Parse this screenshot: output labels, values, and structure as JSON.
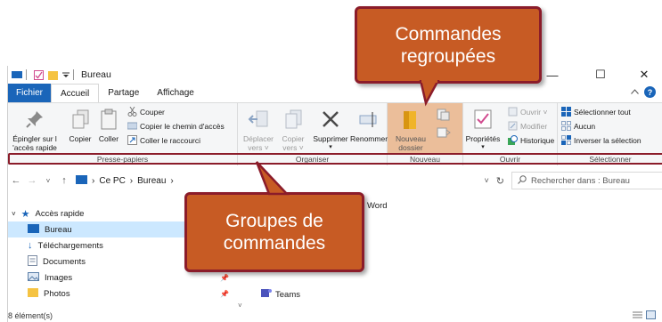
{
  "window": {
    "title": "Bureau",
    "controls": {
      "minimize": "—",
      "maximize": "☐",
      "close": "✕"
    }
  },
  "ribbon_tabs": [
    {
      "label": "Fichier"
    },
    {
      "label": "Accueil"
    },
    {
      "label": "Partage"
    },
    {
      "label": "Affichage"
    }
  ],
  "ribbon": {
    "presse_papiers": {
      "epingler": "Épingler sur l'accès rapide",
      "epingler_l1": "Épingler sur l",
      "epingler_l2": "'accès rapide",
      "copier": "Copier",
      "coller": "Coller",
      "couper": "Couper",
      "copier_chemin": "Copier le chemin d'accès",
      "coller_raccourci": "Coller le raccourci",
      "label": "Presse-papiers"
    },
    "organiser": {
      "deplacer_l1": "Déplacer",
      "deplacer_l2": "vers ˅",
      "copier_l1": "Copier",
      "copier_l2": "vers ˅",
      "supprimer": "Supprimer",
      "renommer": "Renommer",
      "label": "Organiser"
    },
    "nouveau": {
      "dossier_l1": "Nouveau",
      "dossier_l2": "dossier",
      "label": "Nouveau"
    },
    "ouvrir": {
      "proprietes": "Propriétés",
      "ouvrir": "Ouvrir ˅",
      "modifier": "Modifier",
      "historique": "Historique",
      "label": "Ouvrir"
    },
    "selectionner": {
      "tout": "Sélectionner tout",
      "aucun": "Aucun",
      "inverser": "Inverser la sélection",
      "label": "Sélectionner"
    }
  },
  "address_bar": {
    "path": [
      "Ce PC",
      "Bureau"
    ],
    "search_placeholder": "Rechercher dans : Bureau"
  },
  "nav_pane": {
    "items": [
      {
        "label": "Accès rapide",
        "icon": "star-icon"
      },
      {
        "label": "Bureau",
        "icon": "desktop-folder-icon",
        "selected": true
      },
      {
        "label": "Téléchargements",
        "icon": "download-icon"
      },
      {
        "label": "Documents",
        "icon": "documents-icon"
      },
      {
        "label": "Images",
        "icon": "images-icon"
      },
      {
        "label": "Photos",
        "icon": "folder-icon"
      }
    ]
  },
  "content": {
    "item_word": "Word",
    "item_teams": "Teams"
  },
  "status": {
    "count": "8 élément(s)"
  },
  "callouts": {
    "top_l1": "Commandes",
    "top_l2": "regroupées",
    "bottom_l1": "Groupes de",
    "bottom_l2": "commandes"
  },
  "colors": {
    "accent": "#1a65b9",
    "callout_fill": "#c75b24",
    "callout_border": "#8b1c2a",
    "selected_bg": "#cce8ff",
    "nouveau_highlight": "#e9b48a"
  }
}
